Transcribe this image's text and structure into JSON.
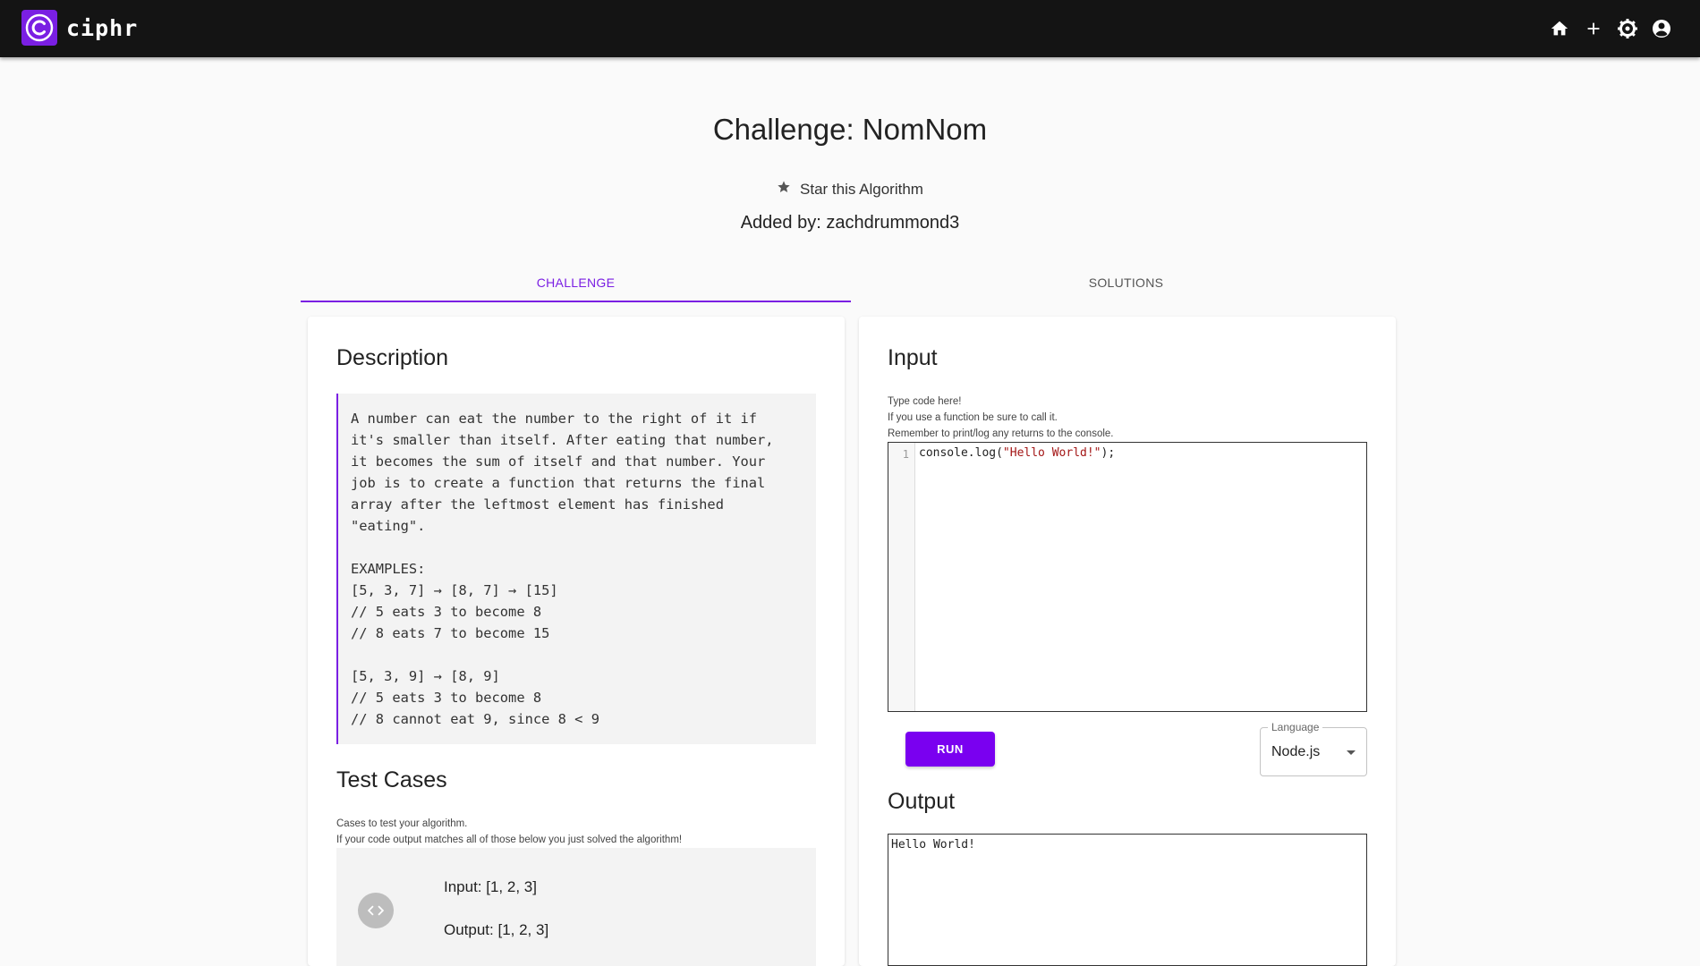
{
  "app": {
    "name": "ciphr"
  },
  "nav": {
    "icons": [
      "home-icon",
      "plus-icon",
      "settings-icon",
      "account-icon"
    ]
  },
  "header": {
    "title": "Challenge: NomNom",
    "star_label": "Star this Algorithm",
    "added_by": "Added by: zachdrummond3"
  },
  "tabs": [
    {
      "label": "CHALLENGE",
      "active": true
    },
    {
      "label": "SOLUTIONS",
      "active": false
    }
  ],
  "description": {
    "heading": "Description",
    "text": "A number can eat the number to the right of it if\nit's smaller than itself. After eating that number,\nit becomes the sum of itself and that number. Your\njob is to create a function that returns the final\narray after the leftmost element has finished\n\"eating\".\n\nEXAMPLES:\n[5, 3, 7] → [8, 7] → [15]\n// 5 eats 3 to become 8\n// 8 eats 7 to become 15\n\n[5, 3, 9] → [8, 9]\n// 5 eats 3 to become 8\n// 8 cannot eat 9, since 8 < 9"
  },
  "test_cases": {
    "heading": "Test Cases",
    "note_1": "Cases to test your algorithm.",
    "note_2": "If your code output matches all of those below you just solved the algorithm!",
    "first": {
      "input": "Input: [1, 2, 3]",
      "output": "Output: [1, 2, 3]"
    }
  },
  "input": {
    "heading": "Input",
    "hint_1": "Type code here!",
    "hint_2": "If you use a function be sure to call it.",
    "hint_3": "Remember to print/log any returns to the console.",
    "line_number": "1",
    "code_prefix": "console.log(",
    "code_string": "\"Hello World!\"",
    "code_suffix": ");"
  },
  "controls": {
    "run_label": "RUN",
    "language_label": "Language",
    "language_value": "Node.js"
  },
  "output": {
    "heading": "Output",
    "text": "Hello World!"
  },
  "colors": {
    "accent": "#7a1fe3",
    "topbar": "#141414",
    "run_button": "#7a00f0"
  }
}
